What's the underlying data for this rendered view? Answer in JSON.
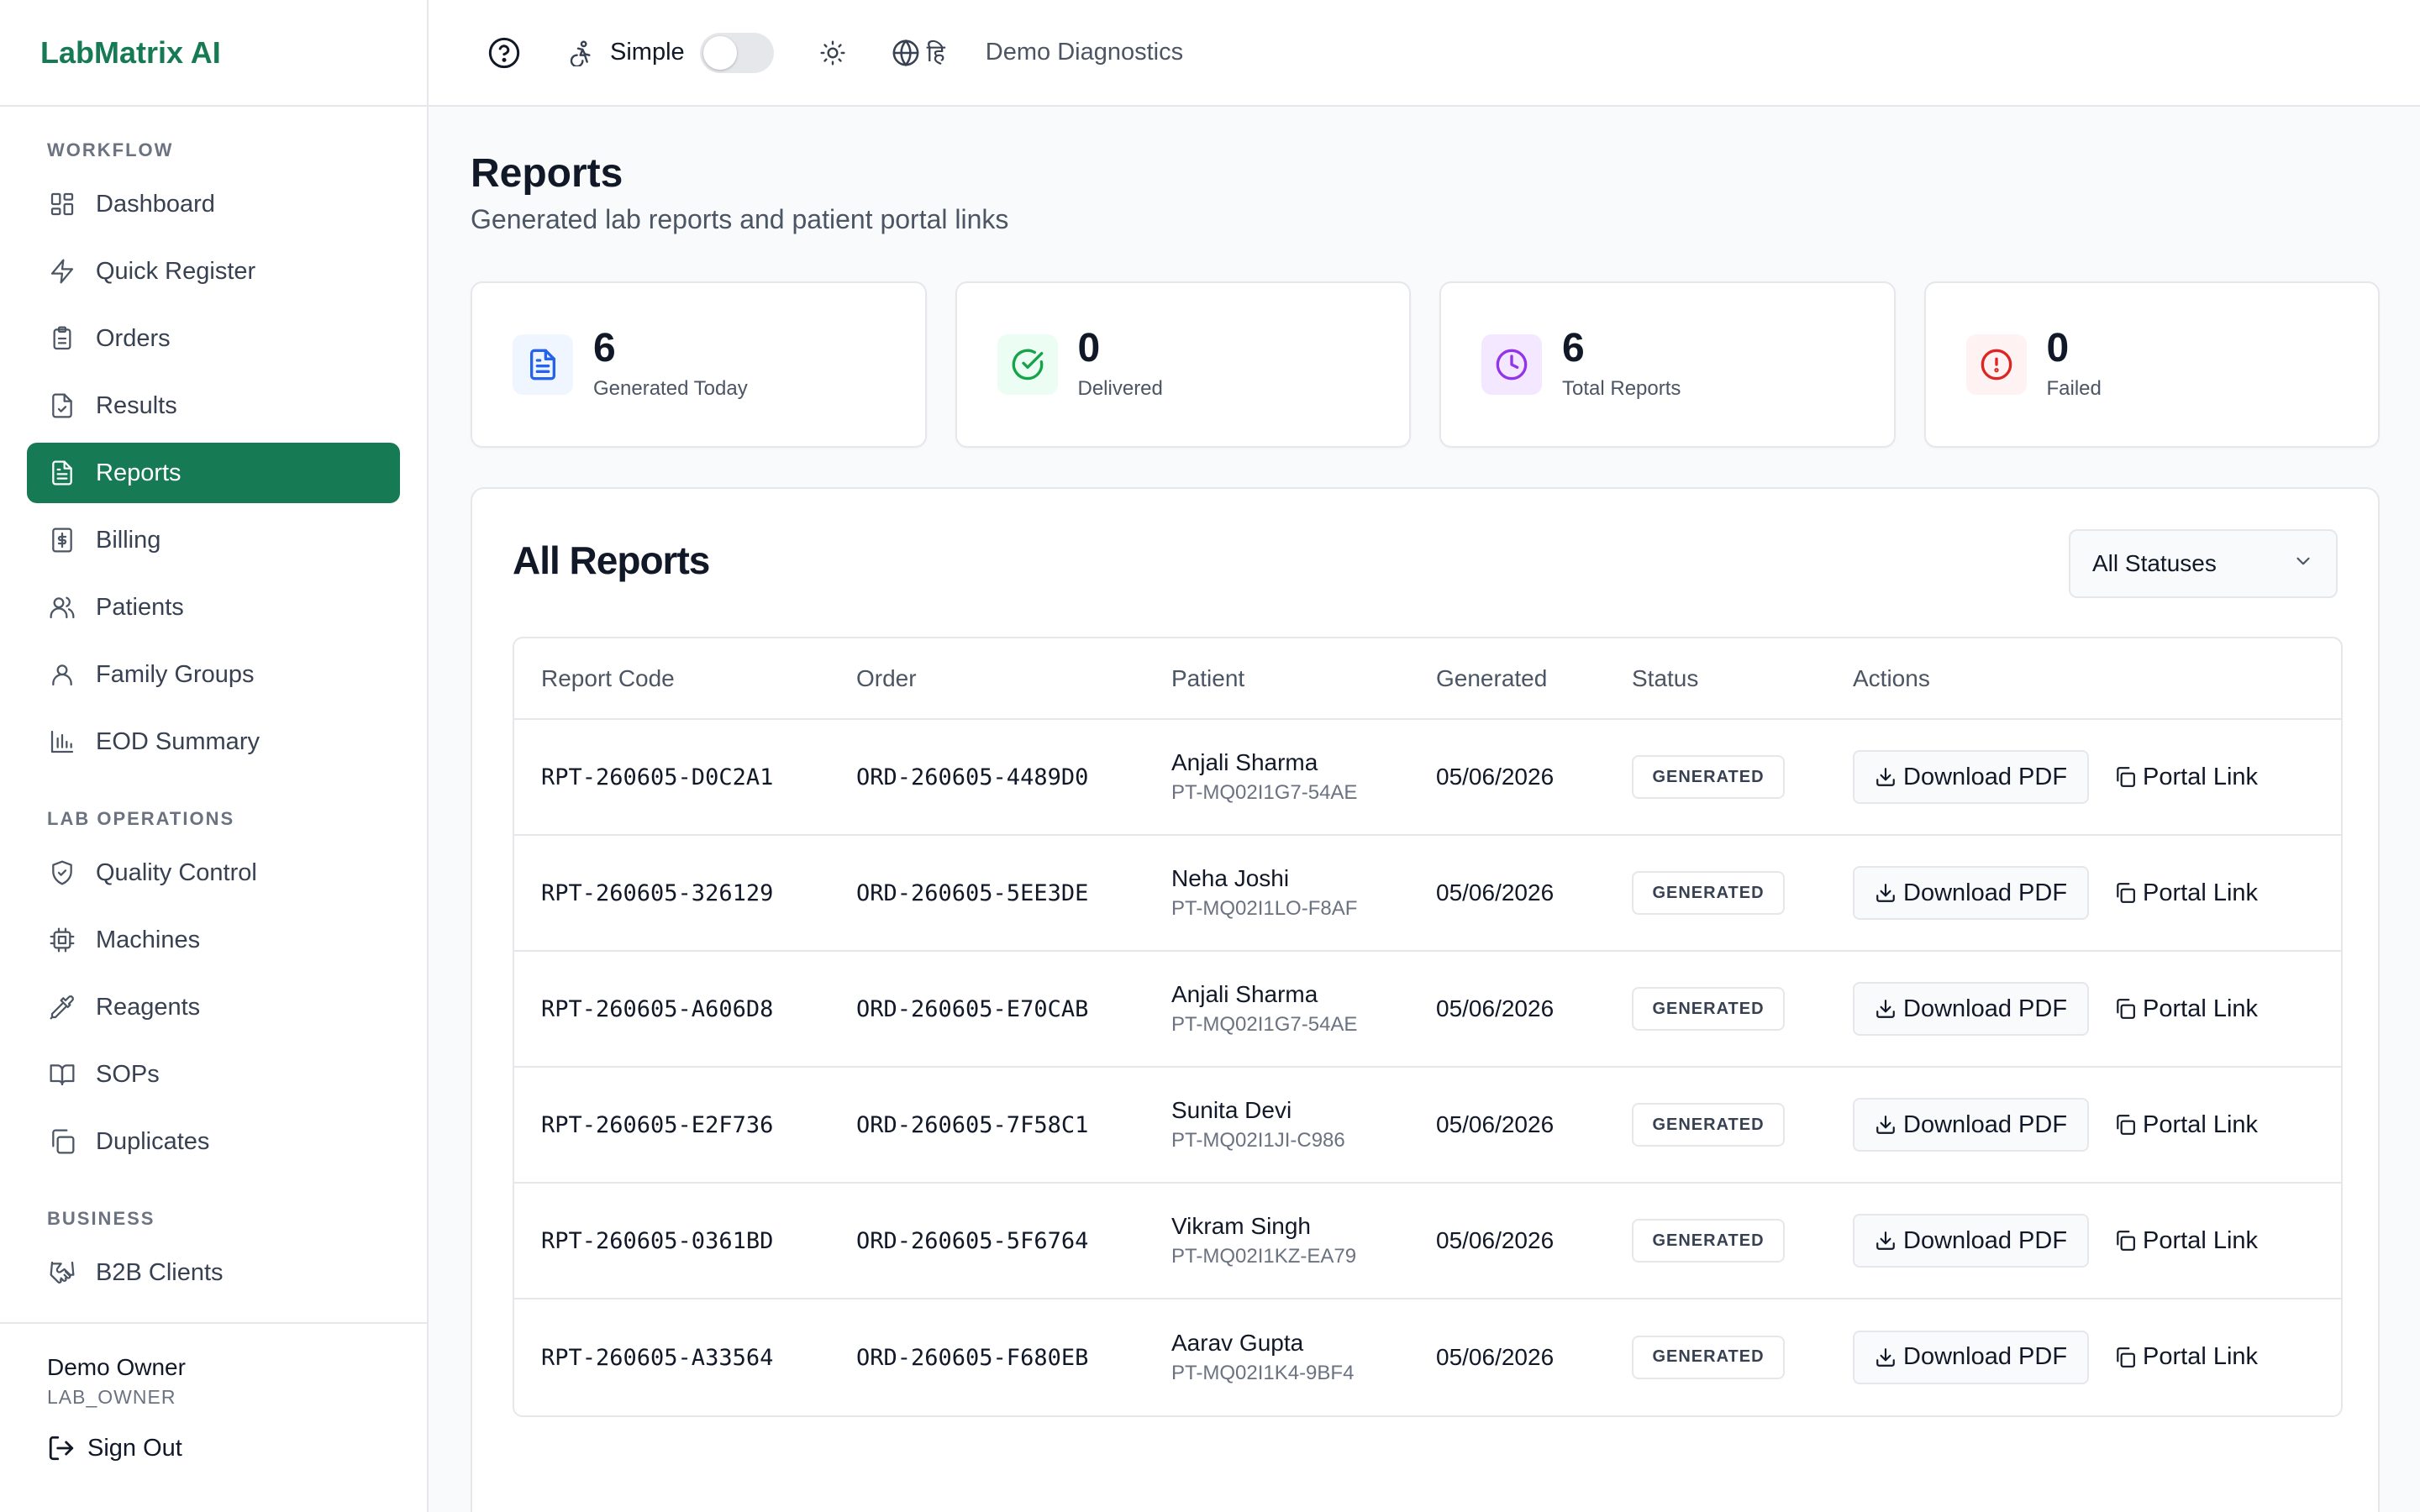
{
  "brand": "LabMatrix AI",
  "topbar": {
    "simple_label": "Simple",
    "lang_label": "हि",
    "lab_name": "Demo Diagnostics"
  },
  "sidebar": {
    "sections": [
      {
        "title": "WORKFLOW",
        "items": [
          {
            "label": "Dashboard",
            "icon": "dashboard-icon"
          },
          {
            "label": "Quick Register",
            "icon": "lightning-icon"
          },
          {
            "label": "Orders",
            "icon": "clipboard-icon"
          },
          {
            "label": "Results",
            "icon": "file-check-icon"
          },
          {
            "label": "Reports",
            "icon": "file-text-icon",
            "active": true
          },
          {
            "label": "Billing",
            "icon": "receipt-icon"
          },
          {
            "label": "Patients",
            "icon": "users-icon"
          },
          {
            "label": "Family Groups",
            "icon": "user-group-icon"
          },
          {
            "label": "EOD Summary",
            "icon": "bar-chart-icon"
          }
        ]
      },
      {
        "title": "LAB OPERATIONS",
        "items": [
          {
            "label": "Quality Control",
            "icon": "shield-check-icon"
          },
          {
            "label": "Machines",
            "icon": "cpu-icon"
          },
          {
            "label": "Reagents",
            "icon": "pipette-icon"
          },
          {
            "label": "SOPs",
            "icon": "book-icon"
          },
          {
            "label": "Duplicates",
            "icon": "copy-icon"
          }
        ]
      },
      {
        "title": "BUSINESS",
        "items": [
          {
            "label": "B2B Clients",
            "icon": "handshake-icon"
          }
        ]
      }
    ],
    "user": {
      "name": "Demo Owner",
      "role": "LAB_OWNER"
    },
    "sign_out": "Sign Out"
  },
  "page": {
    "title": "Reports",
    "subtitle": "Generated lab reports and patient portal links"
  },
  "stats": [
    {
      "value": "6",
      "label": "Generated Today",
      "icon": "file-text-icon",
      "color": "#2563eb",
      "bg": "#eff6ff"
    },
    {
      "value": "0",
      "label": "Delivered",
      "icon": "check-circle-icon",
      "color": "#16a34a",
      "bg": "#ecfdf3"
    },
    {
      "value": "6",
      "label": "Total Reports",
      "icon": "clock-icon",
      "color": "#9333ea",
      "bg": "#f3e8ff"
    },
    {
      "value": "0",
      "label": "Failed",
      "icon": "alert-circle-icon",
      "color": "#dc2626",
      "bg": "#fef2f2"
    }
  ],
  "reports": {
    "title": "All Reports",
    "filter": {
      "selected": "All Statuses"
    },
    "columns": [
      "Report Code",
      "Order",
      "Patient",
      "Generated",
      "Status",
      "Actions"
    ],
    "download_label": "Download PDF",
    "portal_label": "Portal Link",
    "rows": [
      {
        "code": "RPT-260605-D0C2A1",
        "order": "ORD-260605-4489D0",
        "patient": "Anjali Sharma",
        "patient_id": "PT-MQ02I1G7-54AE",
        "generated": "05/06/2026",
        "status": "GENERATED"
      },
      {
        "code": "RPT-260605-326129",
        "order": "ORD-260605-5EE3DE",
        "patient": "Neha Joshi",
        "patient_id": "PT-MQ02I1LO-F8AF",
        "generated": "05/06/2026",
        "status": "GENERATED"
      },
      {
        "code": "RPT-260605-A606D8",
        "order": "ORD-260605-E70CAB",
        "patient": "Anjali Sharma",
        "patient_id": "PT-MQ02I1G7-54AE",
        "generated": "05/06/2026",
        "status": "GENERATED"
      },
      {
        "code": "RPT-260605-E2F736",
        "order": "ORD-260605-7F58C1",
        "patient": "Sunita Devi",
        "patient_id": "PT-MQ02I1JI-C986",
        "generated": "05/06/2026",
        "status": "GENERATED"
      },
      {
        "code": "RPT-260605-0361BD",
        "order": "ORD-260605-5F6764",
        "patient": "Vikram Singh",
        "patient_id": "PT-MQ02I1KZ-EA79",
        "generated": "05/06/2026",
        "status": "GENERATED"
      },
      {
        "code": "RPT-260605-A33564",
        "order": "ORD-260605-F680EB",
        "patient": "Aarav Gupta",
        "patient_id": "PT-MQ02I1K4-9BF4",
        "generated": "05/06/2026",
        "status": "GENERATED"
      }
    ]
  }
}
